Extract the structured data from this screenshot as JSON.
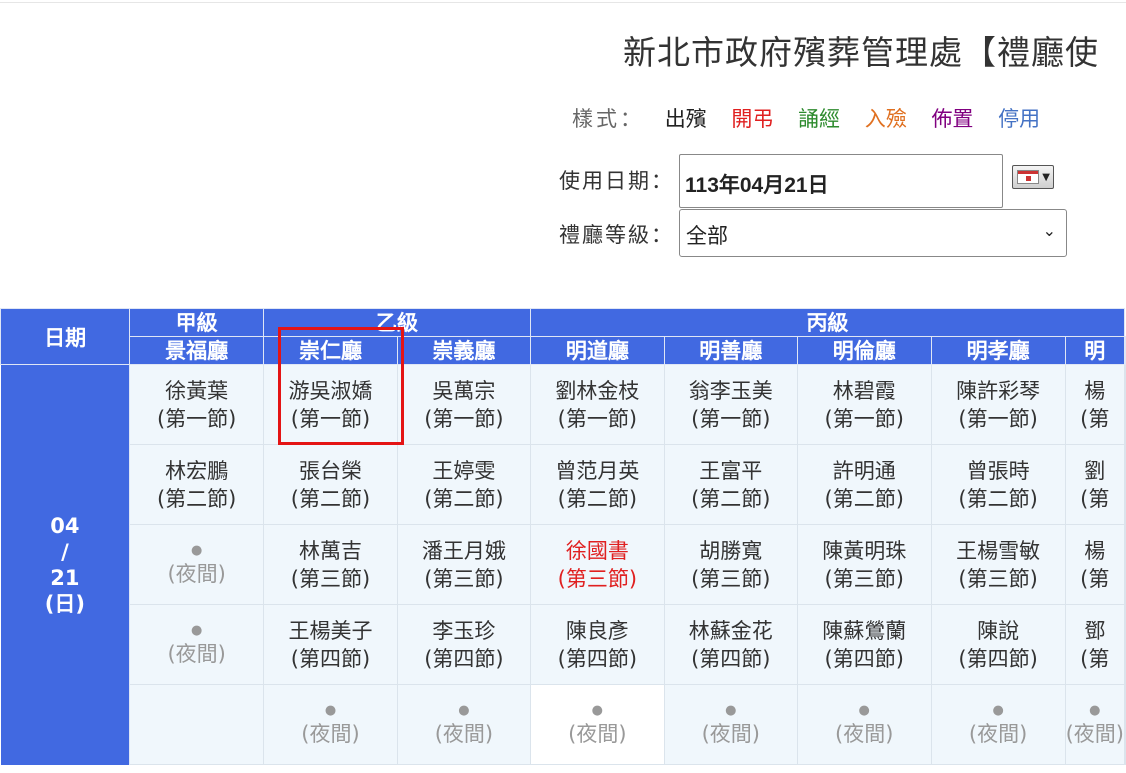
{
  "page": {
    "title": "新北市政府殯葬管理處【禮廳使"
  },
  "legend": {
    "label": "樣式：",
    "items": [
      {
        "text": "出殯",
        "color": "#222222"
      },
      {
        "text": "開弔",
        "color": "#e02020"
      },
      {
        "text": "誦經",
        "color": "#2e8b2e"
      },
      {
        "text": "入殮",
        "color": "#e07020"
      },
      {
        "text": "佈置",
        "color": "#800080"
      },
      {
        "text": "停用",
        "color": "#4472c4"
      }
    ]
  },
  "form": {
    "date_label": "使用日期：",
    "date_value": "113年04月21日",
    "grade_label": "禮廳等級：",
    "grade_value": "全部"
  },
  "table": {
    "date_header": "日期",
    "grades": [
      {
        "name": "甲級"
      },
      {
        "name": "乙級"
      },
      {
        "name": "丙級"
      }
    ],
    "halls": [
      "景福廳",
      "崇仁廳",
      "崇義廳",
      "明道廳",
      "明善廳",
      "明倫廳",
      "明孝廳",
      "明"
    ],
    "date": {
      "month": "04",
      "slash": "/",
      "day": "21",
      "weekday": "(日)"
    },
    "night_dot": "●",
    "night_label": "(夜間)",
    "rows": [
      [
        {
          "name": "徐黃葉",
          "session": "(第一節)"
        },
        {
          "name": "游吳淑嬌",
          "session": "(第一節)"
        },
        {
          "name": "吳萬宗",
          "session": "(第一節)"
        },
        {
          "name": "劉林金枝",
          "session": "(第一節)"
        },
        {
          "name": "翁李玉美",
          "session": "(第一節)"
        },
        {
          "name": "林碧霞",
          "session": "(第一節)"
        },
        {
          "name": "陳許彩琴",
          "session": "(第一節)"
        },
        {
          "name": "楊",
          "session": "(第"
        }
      ],
      [
        {
          "name": "林宏鵬",
          "session": "(第二節)"
        },
        {
          "name": "張台榮",
          "session": "(第二節)"
        },
        {
          "name": "王婷雯",
          "session": "(第二節)"
        },
        {
          "name": "曾范月英",
          "session": "(第二節)"
        },
        {
          "name": "王富平",
          "session": "(第二節)"
        },
        {
          "name": "許明通",
          "session": "(第二節)"
        },
        {
          "name": "曾張時",
          "session": "(第二節)"
        },
        {
          "name": "劉",
          "session": "(第"
        }
      ],
      [
        {
          "night": true
        },
        {
          "name": "林萬吉",
          "session": "(第三節)"
        },
        {
          "name": "潘王月娥",
          "session": "(第三節)"
        },
        {
          "name": "徐國書",
          "session": "(第三節)",
          "red": true
        },
        {
          "name": "胡勝寬",
          "session": "(第三節)"
        },
        {
          "name": "陳黃明珠",
          "session": "(第三節)"
        },
        {
          "name": "王楊雪敏",
          "session": "(第三節)"
        },
        {
          "name": "楊",
          "session": "(第"
        }
      ],
      [
        {
          "night": true
        },
        {
          "name": "王楊美子",
          "session": "(第四節)"
        },
        {
          "name": "李玉珍",
          "session": "(第四節)"
        },
        {
          "name": "陳良彥",
          "session": "(第四節)"
        },
        {
          "name": "林蘇金花",
          "session": "(第四節)"
        },
        {
          "name": "陳蘇鶯蘭",
          "session": "(第四節)"
        },
        {
          "name": "陳說",
          "session": "(第四節)"
        },
        {
          "name": "鄧",
          "session": "(第"
        }
      ],
      [
        {
          "empty": true
        },
        {
          "night": true
        },
        {
          "night": true
        },
        {
          "night": true,
          "white": true
        },
        {
          "night": true
        },
        {
          "night": true
        },
        {
          "night": true
        },
        {
          "night": true
        }
      ]
    ]
  },
  "colors": {
    "header_bg": "#4169e1",
    "cell_bg": "#f0f7fc",
    "highlight": "#e41414"
  }
}
